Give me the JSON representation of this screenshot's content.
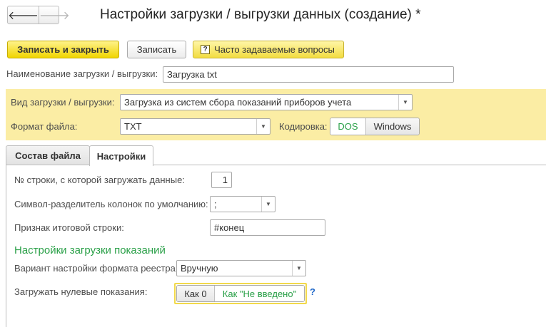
{
  "window": {
    "title": "Настройки загрузки / выгрузки данных (создание) *"
  },
  "nav": {
    "back_glyph": "🡐",
    "forward_glyph": "🡒"
  },
  "toolbar": {
    "save_close_label": "Записать и закрыть",
    "save_label": "Записать",
    "faq_icon": "?",
    "faq_label": "Часто задаваемые вопросы"
  },
  "form": {
    "name_label": "Наименование загрузки / выгрузки:",
    "name_value": "Загрузка txt",
    "type_label": "Вид загрузки / выгрузки:",
    "type_value": "Загрузка из систем сбора показаний приборов учета",
    "format_label": "Формат файла:",
    "format_value": "TXT",
    "encoding_label": "Кодировка:",
    "encoding_options": [
      "DOS",
      "Windows"
    ],
    "encoding_selected": "DOS"
  },
  "tabs": [
    {
      "label": "Состав файла",
      "active": false
    },
    {
      "label": "Настройки",
      "active": true
    }
  ],
  "settings": {
    "start_row_label": "№ строки, с которой загружать данные:",
    "start_row_value": "1",
    "separator_label": "Символ-разделитель колонок по умолчанию:",
    "separator_value": ";",
    "total_row_label": "Признак итоговой строки:",
    "total_row_value": "#конец",
    "section_title": "Настройки загрузки показаний",
    "registry_format_label": "Вариант настройки формата реестра:",
    "registry_format_value": "Вручную",
    "zero_readings_label": "Загружать нулевые показания:",
    "zero_options": [
      "Как 0",
      "Как \"Не введено\""
    ],
    "zero_selected": "Как \"Не введено\"",
    "help_glyph": "?"
  },
  "icons": {
    "dropdown": "▼"
  },
  "colors": {
    "accent_green": "#2aa048",
    "primary_yellow": "#f0d500",
    "panel_yellow": "#fbeda4",
    "help_blue": "#1f68c8"
  }
}
